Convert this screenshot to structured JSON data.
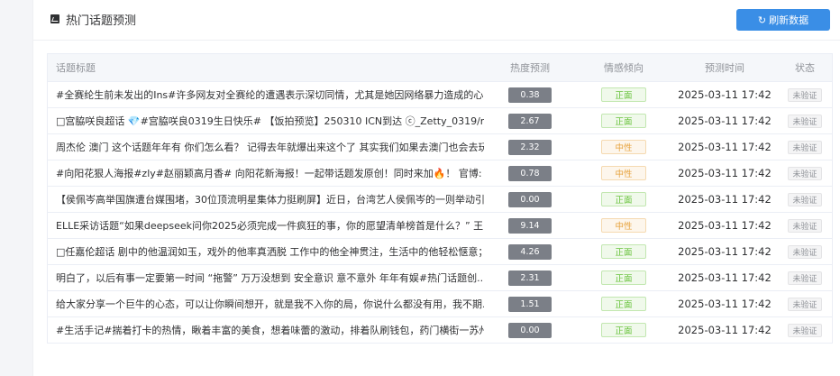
{
  "card": {
    "title": "热门话题预测",
    "refresh_label": "刷新数据",
    "refresh_icon": "refresh-icon"
  },
  "table": {
    "headers": {
      "title": "话题标题",
      "heat": "热度预测",
      "emotion": "情感倾向",
      "time": "预测时间",
      "status": "状态"
    },
    "rows": [
      {
        "title": "#全赛纶生前未发出的Ins#许多网友对全赛纶的遭遇表示深切同情，尤其是她因网络暴力造成的心...",
        "heat": "0.38",
        "emotion": "正面",
        "emotion_type": "pos",
        "time": "2025-03-11 17:42",
        "status": "未验证"
      },
      {
        "title": "□宫脇咲良超话 💎#宫脇咲良0319生日快乐# 【饭拍预览】250310 ICN到达 ⓒ_Zetty_0319/mo...",
        "heat": "2.67",
        "emotion": "正面",
        "emotion_type": "pos",
        "time": "2025-03-11 17:42",
        "status": "未验证"
      },
      {
        "title": "周杰伦 澳门 这个话题年年有 你们怎么看？ 记得去年就爆出来这个了 其实我们如果去澳门也会去玩...",
        "heat": "2.32",
        "emotion": "中性",
        "emotion_type": "neu",
        "time": "2025-03-11 17:42",
        "status": "未验证"
      },
      {
        "title": "#向阳花狠人海报#zly#赵丽颖高月香# 向阳花新海报！一起带话题发原创！同时来加🔥！ 官博: 微...",
        "heat": "0.78",
        "emotion": "中性",
        "emotion_type": "neu",
        "time": "2025-03-11 17:42",
        "status": "未验证"
      },
      {
        "title": "【侯佩岑高举国旗遭台媒围堵，30位顶流明星集体力挺刷屏】近日，台湾艺人侯佩岑的一则举动引...",
        "heat": "0.00",
        "emotion": "正面",
        "emotion_type": "pos",
        "time": "2025-03-11 17:42",
        "status": "未验证"
      },
      {
        "title": "ELLE采访话题“如果deepseek问你2025必须完成一件疯狂的事，你的愿望清单榜首是什么？” 王...",
        "heat": "9.14",
        "emotion": "中性",
        "emotion_type": "neu",
        "time": "2025-03-11 17:42",
        "status": "未验证"
      },
      {
        "title": "□任嘉伦超话 剧中的他温润如玉，戏外的他率真洒脱 工作中的他全神贯注，生活中的他轻松惬意； ...",
        "heat": "4.26",
        "emotion": "正面",
        "emotion_type": "pos",
        "time": "2025-03-11 17:42",
        "status": "未验证"
      },
      {
        "title": "明白了，以后有事一定要第一时间 “拖警” 万万没想到 安全意识 意不意外 年年有娱#热门话题创...",
        "heat": "2.31",
        "emotion": "正面",
        "emotion_type": "pos",
        "time": "2025-03-11 17:42",
        "status": "未验证"
      },
      {
        "title": "给大家分享一个巨牛的心态，可以让你瞬间想开，就是我不入你的局，你说什么都没有用，我不期...",
        "heat": "1.51",
        "emotion": "正面",
        "emotion_type": "pos",
        "time": "2025-03-11 17:42",
        "status": "未验证"
      },
      {
        "title": "#生活手记#揣着打卡的热情，瞅着丰富的美食，想着味蕾的激动，排着队刷钱包，药门横街一苏州...",
        "heat": "0.00",
        "emotion": "正面",
        "emotion_type": "pos",
        "time": "2025-03-11 17:42",
        "status": "未验证"
      }
    ]
  }
}
